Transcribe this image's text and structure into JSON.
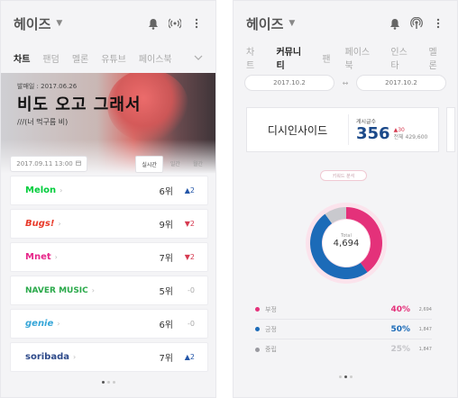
{
  "colors": {
    "negative": "#e4317a",
    "positive": "#1c6bb8",
    "neutral": "#c9c9ce",
    "melon": "#00cd3c",
    "bugs": "#e83a2a",
    "mnet": "#e7278a",
    "naver": "#2aa94a",
    "genie": "#36a6d8",
    "soribada": "#2e4a8a"
  },
  "left": {
    "app_title": "헤이즈",
    "tabs": [
      "차트",
      "팬덤",
      "멜론",
      "유튜브",
      "페이스북"
    ],
    "active_tab": 0,
    "hero": {
      "date": "발매일 : 2017.06.26",
      "title": "비도 오고 그래서",
      "subtitle": "///(너 먹구름 비)"
    },
    "datetime": "2017.09.11 13:00",
    "filters": [
      "실시간",
      "일간",
      "월간"
    ],
    "platforms": [
      {
        "name": "Melon",
        "rank": "6위",
        "change": "▲2",
        "direction": "up"
      },
      {
        "name": "Bugs!",
        "rank": "9위",
        "change": "▼2",
        "direction": "down"
      },
      {
        "name": "Mnet",
        "rank": "7위",
        "change": "▼2",
        "direction": "down"
      },
      {
        "name": "NAVER MUSIC",
        "rank": "5위",
        "change": "-0",
        "direction": "same"
      },
      {
        "name": "genie",
        "rank": "6위",
        "change": "-0",
        "direction": "same"
      },
      {
        "name": "soribada",
        "rank": "7위",
        "change": "▲2",
        "direction": "up"
      }
    ]
  },
  "right": {
    "app_title": "헤이즈",
    "tabs": [
      "차트",
      "커뮤니티",
      "팬",
      "페이스북",
      "인스타",
      "멜론"
    ],
    "active_tab": 1,
    "date_start": "2017.10.2",
    "date_sep": "↔",
    "date_end": "2017.10.2",
    "community": {
      "name": "디시인사이드",
      "post_label": "게시글수",
      "post_count": "356",
      "post_delta": "▲30",
      "post_total": "전체 429,600"
    },
    "keyword_label": "키워드 분석",
    "donut": {
      "total_label": "Total",
      "total": "4,694"
    },
    "sentiment": [
      {
        "label": "부정",
        "percent": "40%",
        "count": "2,694",
        "value": 40,
        "color_key": "negative"
      },
      {
        "label": "긍정",
        "percent": "50%",
        "count": "1,847",
        "value": 50,
        "color_key": "positive"
      },
      {
        "label": "중립",
        "percent": "25%",
        "count": "1,847",
        "value": 10,
        "color_key": "neutral"
      }
    ]
  }
}
